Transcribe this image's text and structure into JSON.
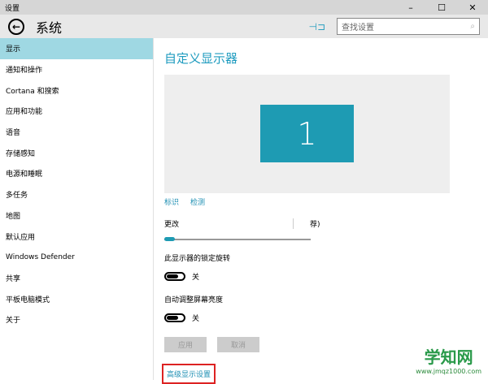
{
  "window": {
    "title": "设置",
    "minimize": "–",
    "maximize": "☐",
    "close": "✕"
  },
  "header": {
    "back": "←",
    "title": "系统",
    "pin": "⊣⊐",
    "search_placeholder": "查找设置",
    "search_icon": "⌕"
  },
  "sidebar": {
    "items": [
      {
        "label": "显示"
      },
      {
        "label": "通知和操作"
      },
      {
        "label": "Cortana 和搜索"
      },
      {
        "label": "应用和功能"
      },
      {
        "label": "语音"
      },
      {
        "label": "存储感知"
      },
      {
        "label": "电源和睡眠"
      },
      {
        "label": "多任务"
      },
      {
        "label": "地图"
      },
      {
        "label": "默认应用"
      },
      {
        "label": "Windows Defender"
      },
      {
        "label": "共享"
      },
      {
        "label": "平板电脑模式"
      },
      {
        "label": "关于"
      }
    ]
  },
  "main": {
    "title": "自定义显示器",
    "monitor_number": "1",
    "identify": "标识",
    "detect": "检测",
    "scale_label": "更改",
    "scale_value": "荐)",
    "scale_fraction": 0,
    "rotation_lock_label": "此显示器的锁定旋转",
    "rotation_lock_state": "关",
    "auto_brightness_label": "自动调整屏幕亮度",
    "auto_brightness_state": "关",
    "apply": "应用",
    "cancel": "取消",
    "advanced": "高级显示设置"
  },
  "watermark": {
    "name": "学知网",
    "url": "www.jmqz1000.com"
  }
}
